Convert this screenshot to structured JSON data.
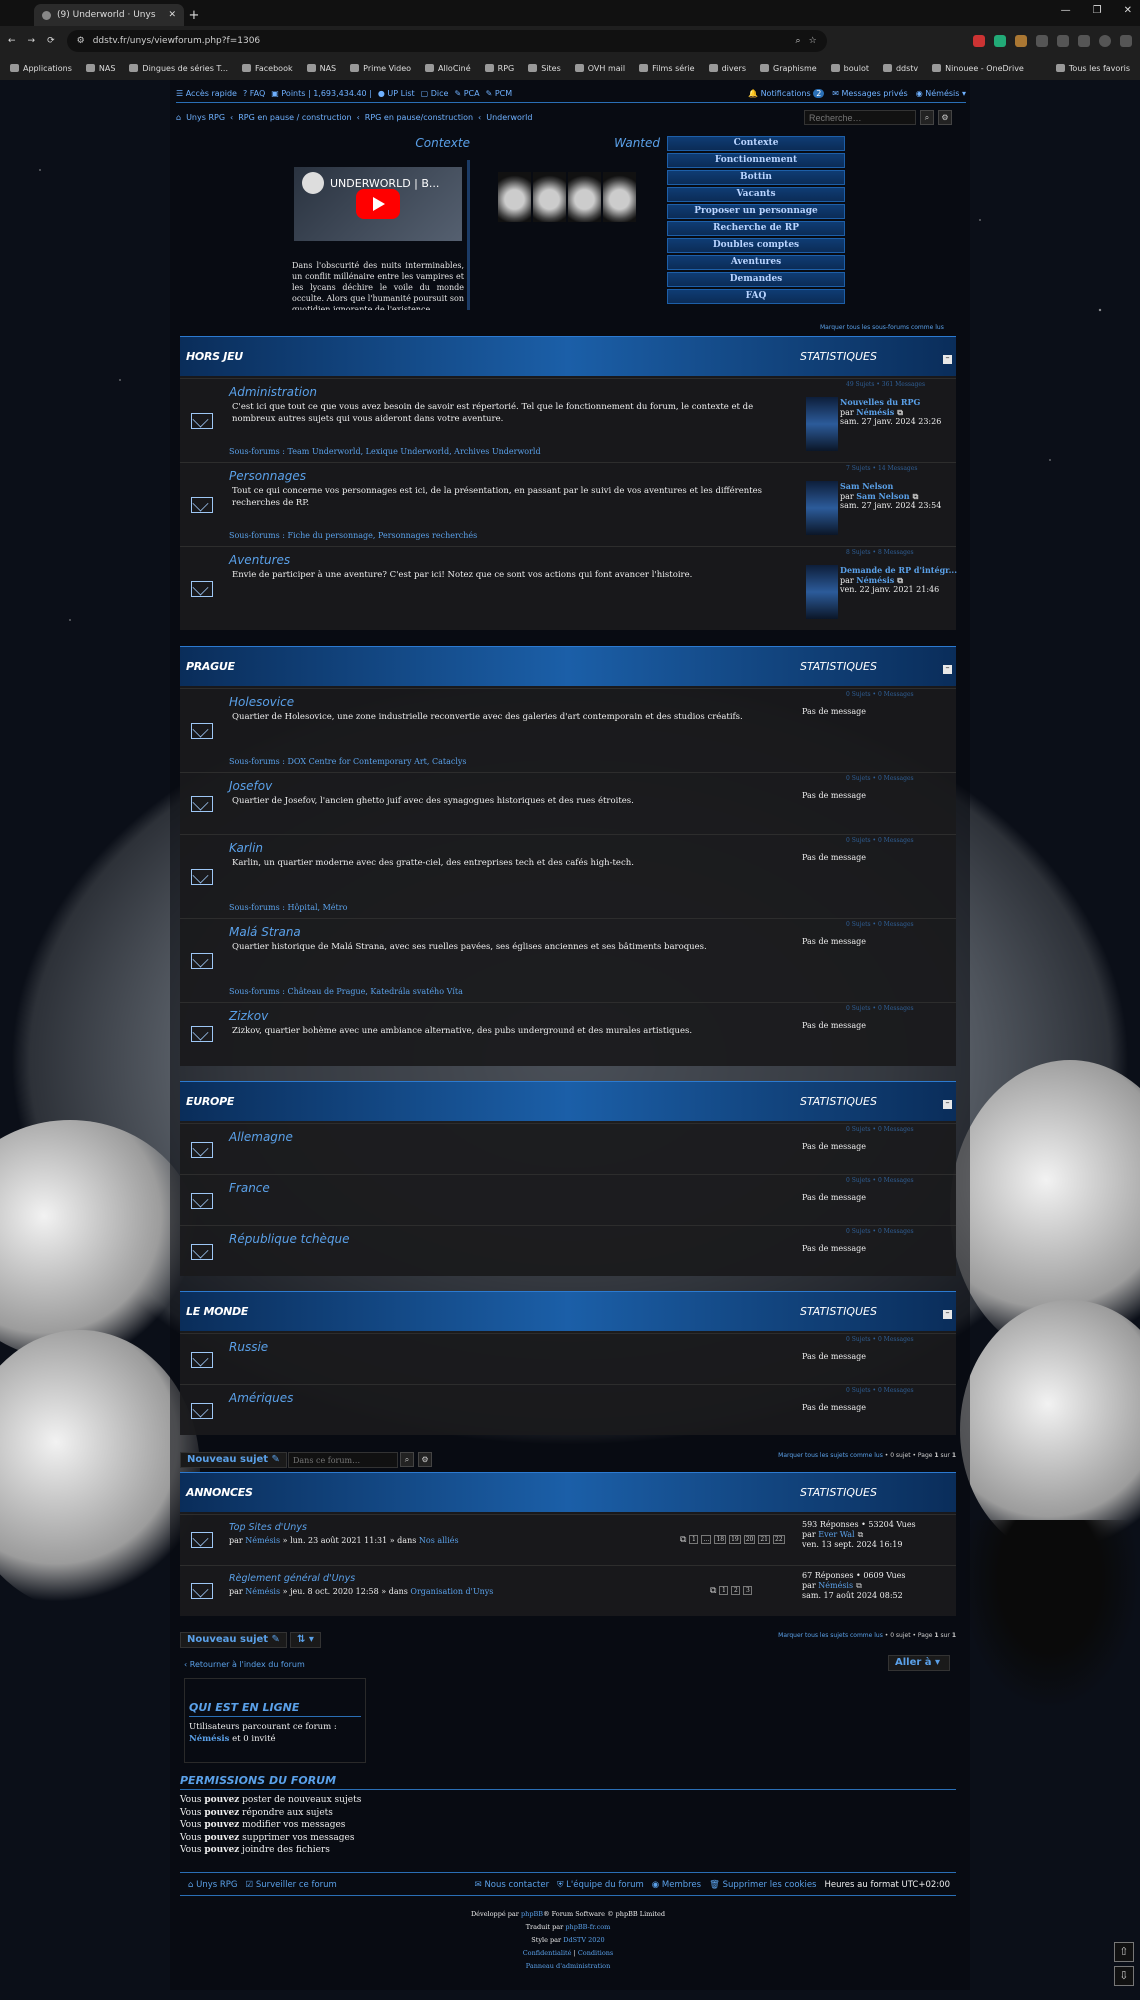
{
  "browser": {
    "tab_title": "(9) Underworld · Unys",
    "url": "ddstv.fr/unys/viewforum.php?f=1306",
    "bookmarks": [
      "Applications",
      "NAS",
      "Dingues de séries T...",
      "Facebook",
      "NAS",
      "Prime Video",
      "AlloCiné",
      "RPG",
      "Sites",
      "OVH mail",
      "Films série",
      "divers",
      "Graphisme",
      "boulot",
      "ddstv",
      "Ninouee - OneDrive"
    ],
    "all_bookmarks": "Tous les favoris"
  },
  "topnav": {
    "quick": "Accès rapide",
    "faq": "FAQ",
    "points": "Points | 1,693,434.40 |",
    "uplist": "UP List",
    "dice": "Dice",
    "pca": "PCA",
    "pcm": "PCM",
    "notif": "Notifications",
    "notif_count": "2",
    "pm": "Messages privés",
    "user": "Némésis"
  },
  "breadcrumbs": [
    "Unys RPG",
    "RPG en pause / construction",
    "RPG en pause/construction",
    "Underworld"
  ],
  "search_placeholder": "Recherche…",
  "header": {
    "context_title": "Contexte",
    "wanted_title": "Wanted",
    "video_title": "UNDERWORLD | B...",
    "context_text": "Dans l'obscurité des nuits interminables, un conflit millénaire entre les vampires et les lycans déchire le voile du monde occulte. Alors que l'humanité poursuit son quotidien ignorante de l'existence",
    "menu": [
      "Contexte",
      "Fonctionnement",
      "Bottin",
      "Vacants",
      "Proposer un personnage",
      "Recherche de RP",
      "Doubles comptes",
      "Aventures",
      "Demandes",
      "FAQ"
    ],
    "mark_all": "Marquer tous les sous-forums comme lus"
  },
  "stats_label": "STATISTIQUES",
  "no_message": "Pas de message",
  "subforums_label": "Sous-forums :",
  "categories": [
    {
      "name": "HORS JEU",
      "forums": [
        {
          "name": "Administration",
          "desc": "C'est ici que tout ce que vous avez besoin de savoir est répertorié. Tel que le fonctionnement du forum, le contexte et de nombreux autres sujets qui vous aideront dans votre aventure.",
          "stats": "49 Sujets • 361 Messages",
          "subs": "Team Underworld, Lexique Underworld, Archives Underworld",
          "lp_title": "Nouvelles du RPG",
          "lp_by": "Némésis",
          "lp_date": "sam. 27 janv. 2024 23:26"
        },
        {
          "name": "Personnages",
          "desc": "Tout ce qui concerne vos personnages est ici, de la présentation, en passant par le suivi de vos aventures et les différentes recherches de RP.",
          "stats": "7 Sujets • 14 Messages",
          "subs": "Fiche du personnage, Personnages recherchés",
          "lp_title": "Sam Nelson",
          "lp_by": "Sam Nelson",
          "lp_date": "sam. 27 janv. 2024 23:54"
        },
        {
          "name": "Aventures",
          "desc": "Envie de participer à une aventure? C'est par ici! Notez que ce sont vos actions qui font avancer l'histoire.",
          "stats": "8 Sujets • 8 Messages",
          "lp_title": "Demande de RP d'intégr...",
          "lp_by": "Némésis",
          "lp_date": "ven. 22 janv. 2021 21:46"
        }
      ]
    },
    {
      "name": "PRAGUE",
      "forums": [
        {
          "name": "Holesovice",
          "desc": "Quartier de Holesovice, une zone industrielle reconvertie avec des galeries d'art contemporain et des studios créatifs.",
          "stats": "0 Sujets • 0 Messages",
          "subs": "DOX Centre for Contemporary Art, Cataclys"
        },
        {
          "name": "Josefov",
          "desc": "Quartier de Josefov, l'ancien ghetto juif avec des synagogues historiques et des rues étroites.",
          "stats": "0 Sujets • 0 Messages"
        },
        {
          "name": "Karlin",
          "desc": "Karlin, un quartier moderne avec des gratte-ciel, des entreprises tech et des cafés high-tech.",
          "stats": "0 Sujets • 0 Messages",
          "subs": "Hôpital, Métro"
        },
        {
          "name": "Malá Strana",
          "desc": "Quartier historique de Malá Strana, avec ses ruelles pavées, ses églises anciennes et ses bâtiments baroques.",
          "stats": "0 Sujets • 0 Messages",
          "subs": "Château de Prague, Katedrála svatého Víta"
        },
        {
          "name": "Zizkov",
          "desc": "Zizkov, quartier bohème avec une ambiance alternative, des pubs underground et des murales artistiques.",
          "stats": "0 Sujets • 0 Messages"
        }
      ]
    },
    {
      "name": "EUROPE",
      "forums": [
        {
          "name": "Allemagne",
          "stats": "0 Sujets • 0 Messages"
        },
        {
          "name": "France",
          "stats": "0 Sujets • 0 Messages"
        },
        {
          "name": "République tchèque",
          "stats": "0 Sujets • 0 Messages"
        }
      ]
    },
    {
      "name": "LE MONDE",
      "forums": [
        {
          "name": "Russie",
          "stats": "0 Sujets • 0 Messages"
        },
        {
          "name": "Amériques",
          "stats": "0 Sujets • 0 Messages"
        }
      ]
    }
  ],
  "actions": {
    "new_topic": "Nouveau sujet",
    "forum_search": "Dans ce forum…",
    "mark_topics": "Marquer tous les sujets comme lus",
    "topic_count": "• 0 sujet • Page",
    "page_cur": "1",
    "page_of": "sur",
    "page_total": "1"
  },
  "announcements": {
    "title": "ANNONCES",
    "topics": [
      {
        "name": "Top Sites d'Unys",
        "by_prefix": "par",
        "by": "Némésis",
        "date": "» lun. 23 août 2021 11:31 » dans",
        "in": "Nos alliés",
        "replies": "593 Réponses • 53204 Vues",
        "lp_by": "Ever Wal",
        "lp_date": "ven. 13 sept. 2024 16:19",
        "pages": [
          "1",
          "…",
          "18",
          "19",
          "20",
          "21",
          "22"
        ]
      },
      {
        "name": "Règlement général d'Unys",
        "by_prefix": "par",
        "by": "Némésis",
        "date": "» jeu. 8 oct. 2020 12:58 » dans",
        "in": "Organisation d'Unys",
        "replies": "67 Réponses • 0609 Vues",
        "lp_by": "Némésis",
        "lp_date": "sam. 17 août 2024 08:52",
        "pages": [
          "1",
          "2",
          "3"
        ]
      }
    ]
  },
  "bottom": {
    "back": "Retourner à l'index du forum",
    "jump": "Aller à",
    "online_title": "QUI EST EN LIGNE",
    "online_text": "Utilisateurs parcourant ce forum :",
    "online_user": "Némésis",
    "online_rest": "et 0 invité",
    "perm_title": "PERMISSIONS DU FORUM",
    "perms": [
      {
        "a": "Vous",
        "b": "pouvez",
        "c": "poster de nouveaux sujets"
      },
      {
        "a": "Vous",
        "b": "pouvez",
        "c": "répondre aux sujets"
      },
      {
        "a": "Vous",
        "b": "pouvez",
        "c": "modifier vos messages"
      },
      {
        "a": "Vous",
        "b": "pouvez",
        "c": "supprimer vos messages"
      },
      {
        "a": "Vous",
        "b": "pouvez",
        "c": "joindre des fichiers"
      }
    ]
  },
  "footer": {
    "home": "Unys RPG",
    "watch": "Surveiller ce forum",
    "contact": "Nous contacter",
    "team": "L'équipe du forum",
    "members": "Membres",
    "cookies": "Supprimer les cookies",
    "tz": "Heures au format UTC+02:00",
    "dev": "Développé par",
    "phpbb": "phpBB",
    "dev2": "® Forum Software © phpBB Limited",
    "trad": "Traduit par",
    "trad_link": "phpBB-fr.com",
    "style": "Style par",
    "style_link": "DdSTV 2020",
    "privacy": "Confidentialité",
    "terms": "Conditions",
    "admin": "Panneau d'administration"
  },
  "colors": {
    "accent": "#5aa0e8",
    "header_blue": "#1b5fa8"
  }
}
